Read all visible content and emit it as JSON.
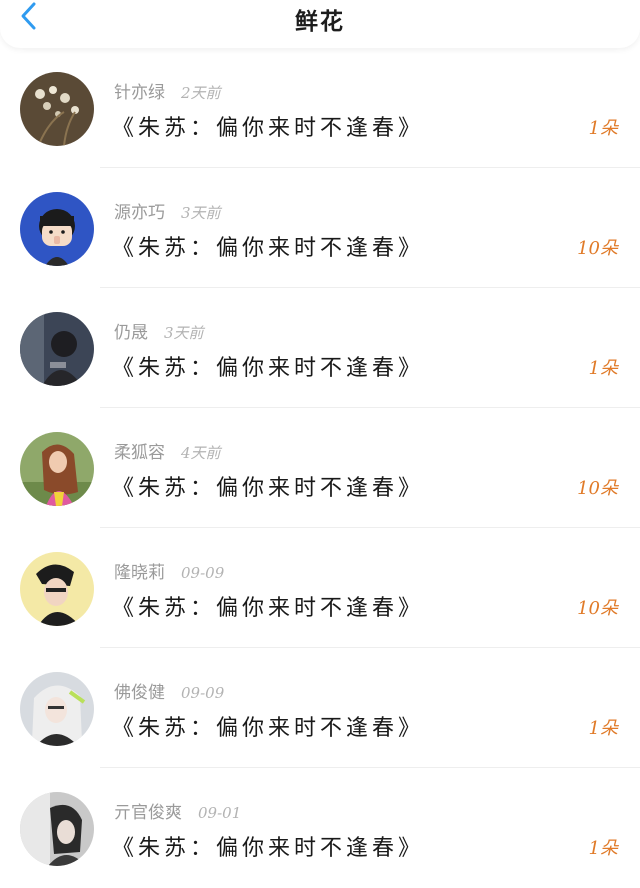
{
  "header": {
    "title": "鲜花",
    "back_icon": "chevron-left-icon",
    "accent": "#2f9bf0"
  },
  "colors": {
    "count": "#e07a28",
    "name": "#9a9a9a"
  },
  "items": [
    {
      "name": "针亦绿",
      "time": "2天前",
      "work": "《朱苏：偏你来时不逢春》",
      "count": "1朵"
    },
    {
      "name": "源亦巧",
      "time": "3天前",
      "work": "《朱苏：偏你来时不逢春》",
      "count": "10朵"
    },
    {
      "name": "仍晟",
      "time": "3天前",
      "work": "《朱苏：偏你来时不逢春》",
      "count": "1朵"
    },
    {
      "name": "柔狐容",
      "time": "4天前",
      "work": "《朱苏：偏你来时不逢春》",
      "count": "10朵"
    },
    {
      "name": "隆晓莉",
      "time": "09-09",
      "work": "《朱苏：偏你来时不逢春》",
      "count": "10朵"
    },
    {
      "name": "佛俊健",
      "time": "09-09",
      "work": "《朱苏：偏你来时不逢春》",
      "count": "1朵"
    },
    {
      "name": "亓官俊爽",
      "time": "09-01",
      "work": "《朱苏：偏你来时不逢春》",
      "count": "1朵"
    }
  ]
}
